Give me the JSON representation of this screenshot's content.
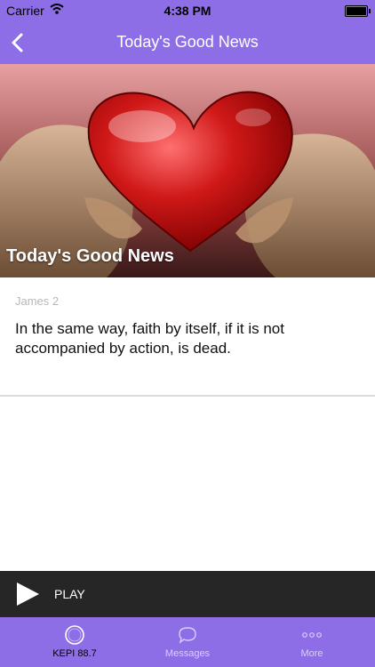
{
  "status_bar": {
    "carrier": "Carrier",
    "time": "4:38 PM"
  },
  "nav": {
    "title": "Today's Good News",
    "back_icon": "chevron-left-icon"
  },
  "hero": {
    "caption": "Today's Good News",
    "image": "heart-in-hands"
  },
  "content": {
    "reference": "James 2",
    "verse": "In the same way, faith by itself, if it is not accompanied by action, is dead."
  },
  "player": {
    "label": "PLAY",
    "icon": "play-icon"
  },
  "tabs": [
    {
      "label": "KEPI 88.7",
      "icon": "radio-circle-icon",
      "active": true
    },
    {
      "label": "Messages",
      "icon": "chat-bubble-icon",
      "active": false
    },
    {
      "label": "More",
      "icon": "more-dots-icon",
      "active": false
    }
  ],
  "colors": {
    "accent": "#8e6ee6",
    "player_bg": "#262626",
    "tab_inactive": "#d9cfff"
  }
}
